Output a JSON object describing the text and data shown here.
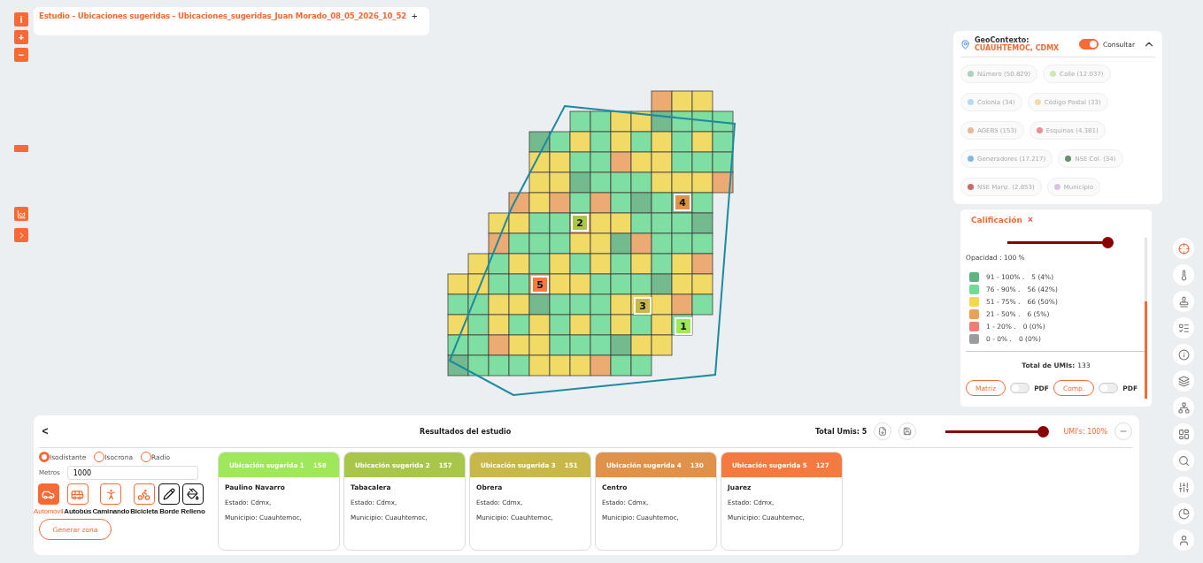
{
  "study_bar": {
    "title": "Estudio - Ubicaciones sugeridas - Ubicaciones_sugeridas_Juan Morado_08_05_2026_10_52",
    "add_symbol": "+"
  },
  "map_controls": {
    "info": "i",
    "zoom_in": "+",
    "zoom_out": "−"
  },
  "map": {
    "markers": [
      {
        "label": "1",
        "color": "#9ee85a"
      },
      {
        "label": "2",
        "color": "#a8c64a"
      },
      {
        "label": "3",
        "color": "#c8b84a"
      },
      {
        "label": "4",
        "color": "#e0914a"
      },
      {
        "label": "5",
        "color": "#f57a40"
      }
    ]
  },
  "geocontexto": {
    "title": "GeoContexto:",
    "place": "CUAUHTEMOC, CDMX",
    "consultar": {
      "label": "Consultar",
      "on": true
    },
    "expanded": true,
    "chips": [
      {
        "label": "Número (50.829)",
        "color": "#a9d3bd"
      },
      {
        "label": "Calle (12.037)",
        "color": "#cfe8b8"
      },
      {
        "label": "Colonia (34)",
        "color": "#b5dcf3"
      },
      {
        "label": "Código Postal (33)",
        "color": "#f3dca8"
      },
      {
        "label": "AGEBS (153)",
        "color": "#e9b896"
      },
      {
        "label": "Esquinas (4.381)",
        "color": "#ee8f8f"
      },
      {
        "label": "Generadores (17.217)",
        "color": "#86b9e2"
      },
      {
        "label": "NSE Col. (34)",
        "color": "#6a8f70"
      },
      {
        "label": "NSE Manz. (2.853)",
        "color": "#c96a6a"
      },
      {
        "label": "Municipio",
        "color": "#d9c2e6"
      }
    ]
  },
  "calificacion": {
    "title": "Calificación",
    "close": "×",
    "opacity": {
      "level": 1,
      "label": "Opacidad : 100 %"
    },
    "legend": [
      {
        "range": "91 - 100% .",
        "count": "5 (4%)",
        "color": "#5fb37e"
      },
      {
        "range": "76 - 90% .",
        "count": "56 (42%)",
        "color": "#6ddc94"
      },
      {
        "range": "51 - 75% .",
        "count": "66 (50%)",
        "color": "#f3d84e"
      },
      {
        "range": "21 - 50% .",
        "count": "6 (5%)",
        "color": "#eda05c"
      },
      {
        "range": "1 - 20% .",
        "count": "0 (0%)",
        "color": "#ee7f77"
      },
      {
        "range": "0 - 0% .",
        "count": "0 (0%)",
        "color": "#9a9d9f"
      }
    ],
    "total_label": "Total de UMIs:",
    "total_value": "133",
    "exports": [
      {
        "button": "Matriz",
        "pdf_on": false,
        "pdf_label": "PDF"
      },
      {
        "button": "Comp.",
        "pdf_on": false,
        "pdf_label": "PDF"
      }
    ]
  },
  "results": {
    "back": "<",
    "title": "Resultados del estudio",
    "total": "Total Umis: 5",
    "umi": {
      "level": 1,
      "label": "UMI's: 100%"
    },
    "zone_types": [
      {
        "label": "Isodistante",
        "selected": true
      },
      {
        "label": "Isocrona",
        "selected": false
      },
      {
        "label": "Radio",
        "selected": false
      }
    ],
    "meters": {
      "label": "Metros",
      "value": "1000"
    },
    "modes": [
      {
        "kind": "car",
        "label": "Automóvil",
        "selected": true
      },
      {
        "kind": "bus",
        "label": "Autobús",
        "selected": false
      },
      {
        "kind": "walk",
        "label": "Caminando",
        "selected": false
      },
      {
        "kind": "bike",
        "label": "Bicicleta",
        "selected": false
      },
      {
        "kind": "border",
        "label": "Borde",
        "selected": false
      },
      {
        "kind": "fill",
        "label": "Relleno",
        "selected": false
      }
    ],
    "generate": "Generar zona",
    "cards": [
      {
        "title": "Ubicación sugerida 1",
        "score": "158",
        "color": "#9ee85a",
        "name": "Paulino Navarro",
        "estado": "Estado: Cdmx,",
        "municipio": "Municipio: Cuauhtemoc,"
      },
      {
        "title": "Ubicación sugerida 2",
        "score": "157",
        "color": "#a8c64a",
        "name": "Tabacalera",
        "estado": "Estado: Cdmx,",
        "municipio": "Municipio: Cuauhtemoc,"
      },
      {
        "title": "Ubicación sugerida 3",
        "score": "151",
        "color": "#c8b84a",
        "name": "Obrera",
        "estado": "Estado: Cdmx,",
        "municipio": "Municipio: Cuauhtemoc,"
      },
      {
        "title": "Ubicación sugerida 4",
        "score": "130",
        "color": "#e0914a",
        "name": "Centro",
        "estado": "Estado: Cdmx,",
        "municipio": "Municipio: Cuauhtemoc,"
      },
      {
        "title": "Ubicación sugerida 5",
        "score": "127",
        "color": "#f57a40",
        "name": "Juarez",
        "estado": "Estado: Cdmx,",
        "municipio": "Municipio: Cuauhtemoc,"
      }
    ]
  }
}
